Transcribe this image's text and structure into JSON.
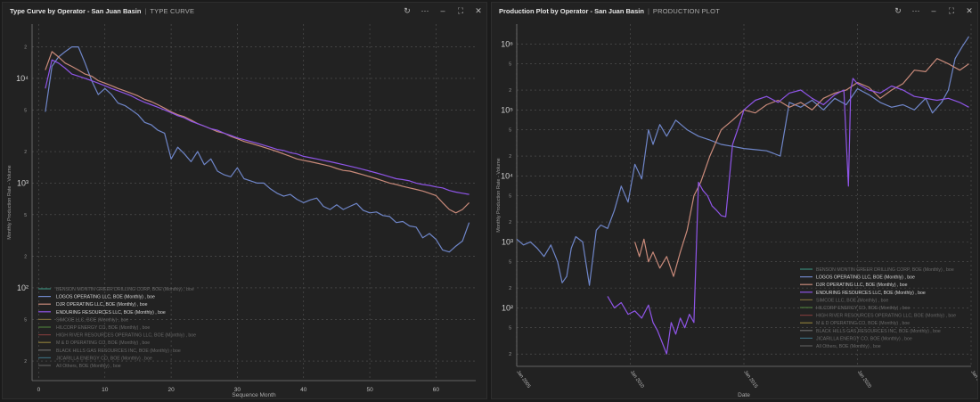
{
  "left_panel": {
    "title": "Type Curve by Operator - San Juan Basin",
    "subtitle": "TYPE CURVE",
    "icons": [
      "refresh-icon",
      "more-icon",
      "minimize-icon",
      "maximize-icon",
      "close-icon"
    ]
  },
  "right_panel": {
    "title": "Production Plot by Operator - San Juan Basin",
    "subtitle": "PRODUCTION PLOT",
    "icons": [
      "refresh-icon",
      "more-icon",
      "minimize-icon",
      "maximize-icon",
      "close-icon"
    ]
  },
  "legend_entries": [
    {
      "name": "BENSON MONTIN GREER DRILLING CORP, BOE (Monthly) , boe",
      "color": "#3a8a7a",
      "active": false
    },
    {
      "name": "LOGOS OPERATING LLC, BOE (Monthly) , boe",
      "color": "#6f86c9",
      "active": true
    },
    {
      "name": "DJR OPERATING LLC, BOE (Monthly) , boe",
      "color": "#c98a7a",
      "active": true
    },
    {
      "name": "ENDURING RESOURCES LLC, BOE (Monthly) , boe",
      "color": "#8f55e8",
      "active": true
    },
    {
      "name": "SIMCOE LLC, BOE (Monthly) , boe",
      "color": "#7a6a3a",
      "active": false
    },
    {
      "name": "HILCORP ENERGY CO, BOE (Monthly) , boe",
      "color": "#4a7a3a",
      "active": false
    },
    {
      "name": "HIGH RIVER RESOURCES OPERATING LLC, BOE (Monthly) , boe",
      "color": "#7a3a3a",
      "active": false
    },
    {
      "name": "M & D OPERATING CO, BOE (Monthly) , boe",
      "color": "#8a7a3a",
      "active": false
    },
    {
      "name": "BLACK HILLS GAS RESOURCES INC, BOE (Monthly) , boe",
      "color": "#6a6a6a",
      "active": false
    },
    {
      "name": "JICARILLA ENERGY CO, BOE (Monthly) , boe",
      "color": "#3a6a7a",
      "active": false
    },
    {
      "name": "All Others, BOE (Monthly) , boe",
      "color": "#5a5a5a",
      "active": false
    }
  ],
  "chart_data": [
    {
      "type": "line",
      "title": "Type Curve by Operator - San Juan Basin",
      "xlabel": "Sequence Month",
      "ylabel": "Monthly Production Rate - Volume",
      "y_scale": "log",
      "xlim": [
        -1,
        66
      ],
      "ylim": [
        13,
        33000
      ],
      "x_ticks": [
        0,
        10,
        20,
        30,
        40,
        50,
        60
      ],
      "y_major_ticks": [
        {
          "v": 100,
          "label": "10²"
        },
        {
          "v": 1000,
          "label": "10³"
        },
        {
          "v": 10000,
          "label": "10⁴"
        }
      ],
      "y_minor_ticks": [
        {
          "v": 20,
          "label": "2"
        },
        {
          "v": 50,
          "label": "5"
        },
        {
          "v": 200,
          "label": "2"
        },
        {
          "v": 500,
          "label": "5"
        },
        {
          "v": 2000,
          "label": "2"
        },
        {
          "v": 5000,
          "label": "5"
        },
        {
          "v": 20000,
          "label": "2"
        }
      ],
      "grid": true,
      "legend_position": "bottom-left",
      "series": [
        {
          "name": "LOGOS OPERATING LLC, BOE (Monthly) , boe",
          "color": "#6f86c9",
          "x": [
            1,
            2,
            3,
            4,
            5,
            6,
            7,
            8,
            9,
            10,
            11,
            12,
            13,
            14,
            15,
            16,
            17,
            18,
            19,
            20,
            21,
            22,
            23,
            24,
            25,
            26,
            27,
            28,
            29,
            30,
            31,
            32,
            33,
            34,
            35,
            36,
            37,
            38,
            39,
            40,
            41,
            42,
            43,
            44,
            45,
            46,
            47,
            48,
            49,
            50,
            51,
            52,
            53,
            54,
            55,
            56,
            57,
            58,
            59,
            60,
            61,
            62,
            63,
            64,
            65
          ],
          "y": [
            4800,
            13000,
            16000,
            18000,
            20000,
            20000,
            14000,
            9500,
            7000,
            8000,
            7000,
            5800,
            5500,
            5000,
            4500,
            3800,
            3600,
            3200,
            3000,
            1700,
            2200,
            1900,
            1600,
            2000,
            1500,
            1700,
            1300,
            1200,
            1150,
            1400,
            1100,
            1050,
            1000,
            1000,
            880,
            800,
            750,
            780,
            700,
            650,
            690,
            720,
            600,
            560,
            620,
            560,
            600,
            640,
            550,
            520,
            530,
            490,
            480,
            420,
            430,
            390,
            380,
            300,
            330,
            290,
            230,
            220,
            250,
            280,
            420
          ]
        },
        {
          "name": "DJR OPERATING LLC, BOE (Monthly) , boe",
          "color": "#c98a7a",
          "x": [
            1,
            2,
            3,
            4,
            5,
            6,
            7,
            8,
            9,
            10,
            11,
            12,
            13,
            14,
            15,
            16,
            17,
            18,
            19,
            20,
            21,
            22,
            23,
            24,
            25,
            26,
            27,
            28,
            29,
            30,
            31,
            32,
            33,
            34,
            35,
            36,
            37,
            38,
            39,
            40,
            41,
            42,
            43,
            44,
            45,
            46,
            47,
            48,
            49,
            50,
            51,
            52,
            53,
            54,
            55,
            56,
            57,
            58,
            59,
            60,
            61,
            62,
            63,
            64,
            65
          ],
          "y": [
            12000,
            18000,
            16000,
            14000,
            13000,
            12000,
            11000,
            10500,
            9500,
            9000,
            8500,
            8000,
            7600,
            7200,
            6800,
            6300,
            6000,
            5600,
            5200,
            4800,
            4500,
            4300,
            4000,
            3700,
            3500,
            3300,
            3100,
            3000,
            2800,
            2650,
            2500,
            2400,
            2300,
            2200,
            2100,
            2000,
            1900,
            1800,
            1700,
            1650,
            1600,
            1550,
            1500,
            1450,
            1380,
            1320,
            1300,
            1250,
            1200,
            1150,
            1100,
            1050,
            1000,
            970,
            930,
            900,
            870,
            840,
            800,
            760,
            650,
            560,
            520,
            560,
            650
          ]
        },
        {
          "name": "ENDURING RESOURCES LLC, BOE (Monthly) , boe",
          "color": "#8f55e8",
          "x": [
            1,
            2,
            3,
            4,
            5,
            6,
            7,
            8,
            9,
            10,
            11,
            12,
            13,
            14,
            15,
            16,
            17,
            18,
            19,
            20,
            21,
            22,
            23,
            24,
            25,
            26,
            27,
            28,
            29,
            30,
            31,
            32,
            33,
            34,
            35,
            36,
            37,
            38,
            39,
            40,
            41,
            42,
            43,
            44,
            45,
            46,
            47,
            48,
            49,
            50,
            51,
            52,
            53,
            54,
            55,
            56,
            57,
            58,
            59,
            60,
            61,
            62,
            63,
            64,
            65
          ],
          "y": [
            8000,
            15000,
            14000,
            12500,
            11000,
            10500,
            10000,
            9500,
            9000,
            8500,
            8000,
            7600,
            7200,
            6800,
            6300,
            5900,
            5600,
            5300,
            5000,
            4700,
            4400,
            4200,
            3900,
            3700,
            3500,
            3300,
            3200,
            3000,
            2850,
            2700,
            2600,
            2500,
            2400,
            2300,
            2200,
            2100,
            2050,
            1950,
            1900,
            1800,
            1750,
            1700,
            1650,
            1600,
            1550,
            1500,
            1450,
            1400,
            1350,
            1300,
            1250,
            1200,
            1150,
            1100,
            1080,
            1050,
            1000,
            970,
            950,
            920,
            900,
            850,
            820,
            800,
            780
          ]
        }
      ]
    },
    {
      "type": "line",
      "title": "Production Plot by Operator - San Juan Basin",
      "xlabel": "Date",
      "ylabel": "Monthly Production Rate - Volume",
      "y_scale": "log",
      "xlim": [
        2005,
        2025
      ],
      "ylim": [
        13,
        2000000
      ],
      "x_ticks": [
        {
          "v": 2005,
          "label": "Jan 2005"
        },
        {
          "v": 2010,
          "label": "Jan 2010"
        },
        {
          "v": 2015,
          "label": "Jan 2015"
        },
        {
          "v": 2020,
          "label": "Jan 2020"
        },
        {
          "v": 2025,
          "label": "Jan 2025"
        }
      ],
      "y_major_ticks": [
        {
          "v": 100,
          "label": "10²"
        },
        {
          "v": 1000,
          "label": "10³"
        },
        {
          "v": 10000,
          "label": "10⁴"
        },
        {
          "v": 100000,
          "label": "10⁵"
        },
        {
          "v": 1000000,
          "label": "10⁶"
        }
      ],
      "y_minor_ticks": [
        {
          "v": 20,
          "label": "2"
        },
        {
          "v": 50,
          "label": "5"
        },
        {
          "v": 200,
          "label": "2"
        },
        {
          "v": 500,
          "label": "5"
        },
        {
          "v": 2000,
          "label": "2"
        },
        {
          "v": 5000,
          "label": "5"
        },
        {
          "v": 20000,
          "label": "2"
        },
        {
          "v": 50000,
          "label": "5"
        },
        {
          "v": 200000,
          "label": "2"
        },
        {
          "v": 500000,
          "label": "5"
        }
      ],
      "grid": true,
      "legend_position": "bottom-right",
      "series": [
        {
          "name": "LOGOS OPERATING LLC, BOE (Monthly) , boe",
          "color": "#6f86c9",
          "x": [
            2005.0,
            2005.3,
            2005.6,
            2005.9,
            2006.2,
            2006.5,
            2006.8,
            2007.0,
            2007.2,
            2007.4,
            2007.6,
            2007.9,
            2008.2,
            2008.5,
            2008.7,
            2009.0,
            2009.3,
            2009.6,
            2009.9,
            2010.2,
            2010.5,
            2010.8,
            2011.0,
            2011.3,
            2011.6,
            2012.0,
            2012.5,
            2013.0,
            2013.5,
            2014.0,
            2014.5,
            2015.0,
            2015.5,
            2016.0,
            2016.3,
            2016.6,
            2017.0,
            2017.5,
            2018.0,
            2018.5,
            2019.0,
            2019.5,
            2020.0,
            2020.5,
            2021.0,
            2021.5,
            2022.0,
            2022.5,
            2023.0,
            2023.3,
            2023.7,
            2024.0,
            2024.3,
            2024.6,
            2024.9
          ],
          "y": [
            1100,
            900,
            1000,
            800,
            600,
            900,
            500,
            240,
            300,
            800,
            1200,
            1000,
            220,
            1500,
            1800,
            1600,
            3000,
            7000,
            4000,
            15000,
            9000,
            50000,
            30000,
            60000,
            40000,
            70000,
            50000,
            40000,
            35000,
            30000,
            28000,
            26000,
            25000,
            24000,
            22000,
            20000,
            130000,
            110000,
            140000,
            100000,
            150000,
            120000,
            210000,
            170000,
            130000,
            110000,
            120000,
            100000,
            150000,
            90000,
            130000,
            200000,
            600000,
            900000,
            1300000
          ]
        },
        {
          "name": "DJR OPERATING LLC, BOE (Monthly) , boe",
          "color": "#c98a7a",
          "x": [
            2010.2,
            2010.4,
            2010.6,
            2010.8,
            2011.0,
            2011.3,
            2011.6,
            2011.9,
            2012.2,
            2012.5,
            2012.8,
            2013.1,
            2013.5,
            2014.0,
            2014.5,
            2015.0,
            2015.5,
            2016.0,
            2016.5,
            2017.0,
            2017.5,
            2018.0,
            2018.5,
            2019.0,
            2019.5,
            2020.0,
            2020.5,
            2021.0,
            2021.5,
            2022.0,
            2022.5,
            2023.0,
            2023.5,
            2024.0,
            2024.5,
            2024.9
          ],
          "y": [
            1000,
            600,
            1100,
            500,
            700,
            400,
            600,
            300,
            700,
            1500,
            5000,
            8000,
            20000,
            50000,
            70000,
            100000,
            90000,
            120000,
            140000,
            110000,
            130000,
            100000,
            150000,
            180000,
            200000,
            260000,
            220000,
            150000,
            200000,
            250000,
            400000,
            380000,
            600000,
            500000,
            400000,
            500000
          ]
        },
        {
          "name": "ENDURING RESOURCES LLC, BOE (Monthly) , boe",
          "color": "#8f55e8",
          "x": [
            2009.0,
            2009.3,
            2009.6,
            2009.9,
            2010.2,
            2010.5,
            2010.8,
            2011.0,
            2011.2,
            2011.4,
            2011.6,
            2011.8,
            2012.0,
            2012.2,
            2012.4,
            2012.6,
            2012.8,
            2013.0,
            2013.2,
            2013.4,
            2013.6,
            2013.8,
            2014.0,
            2014.2,
            2014.5,
            2014.8,
            2015.0,
            2015.5,
            2016.0,
            2016.5,
            2017.0,
            2017.5,
            2018.0,
            2018.5,
            2019.0,
            2019.4,
            2019.6,
            2019.7,
            2019.8,
            2020.0,
            2020.5,
            2021.0,
            2021.5,
            2022.0,
            2022.5,
            2023.0,
            2023.5,
            2024.0,
            2024.5,
            2024.9
          ],
          "y": [
            150,
            100,
            120,
            80,
            90,
            70,
            110,
            60,
            45,
            30,
            20,
            60,
            40,
            70,
            50,
            80,
            60,
            8000,
            6000,
            5000,
            3500,
            3000,
            2500,
            2400,
            30000,
            60000,
            100000,
            140000,
            160000,
            130000,
            180000,
            200000,
            150000,
            120000,
            170000,
            200000,
            7000,
            200000,
            300000,
            250000,
            200000,
            180000,
            230000,
            200000,
            160000,
            150000,
            140000,
            150000,
            130000,
            110000
          ]
        }
      ]
    }
  ]
}
